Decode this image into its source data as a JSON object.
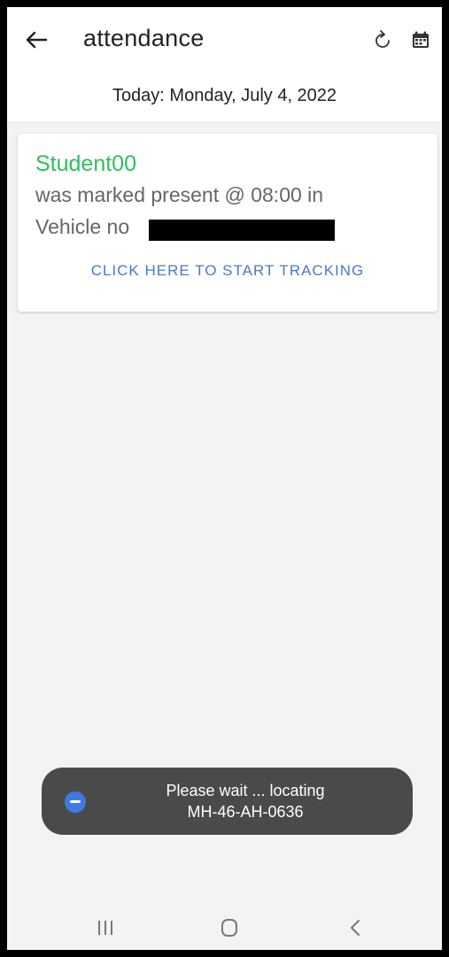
{
  "header": {
    "title": "attendance",
    "icons": [
      "back-arrow-icon",
      "refresh-icon",
      "calendar-icon"
    ]
  },
  "date_line": "Today: Monday, July 4, 2022",
  "card": {
    "student_name": "Student00",
    "status_text": "was marked present @ 08:00 in",
    "vehicle_label": "Vehicle no",
    "action_label": "CLICK HERE TO START TRACKING"
  },
  "toast": {
    "line1": "Please wait ... locating",
    "line2": "MH-46-AH-0636"
  },
  "colors": {
    "student_name": "#2fbf5c",
    "action": "#4a79c9",
    "toast_bg": "#4a4a4a",
    "toast_icon": "#3d7ae6"
  }
}
